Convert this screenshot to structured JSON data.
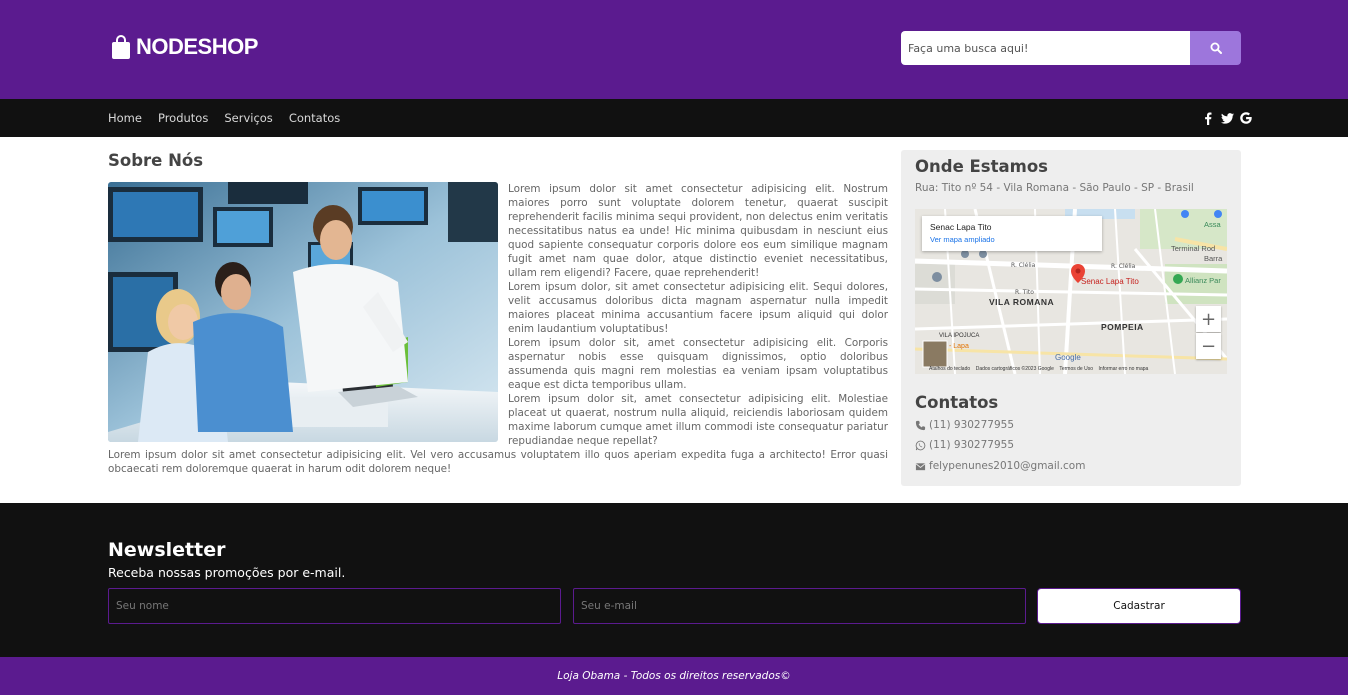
{
  "header": {
    "brand": "NODESHOP",
    "search_placeholder": "Faça uma busca aqui!",
    "colors": {
      "primary": "#5b1b8f",
      "search_button": "#9d76dc",
      "dark": "#111111"
    }
  },
  "nav": {
    "items": [
      {
        "label": "Home"
      },
      {
        "label": "Produtos"
      },
      {
        "label": "Serviços"
      },
      {
        "label": "Contatos"
      }
    ],
    "social_icons": [
      "facebook-icon",
      "twitter-icon",
      "google-icon"
    ]
  },
  "about": {
    "title": "Sobre Nós",
    "paragraphs": [
      "Lorem ipsum dolor sit amet consectetur adipisicing elit. Nostrum maiores porro sunt voluptate dolorem tenetur, quaerat suscipit reprehenderit facilis minima sequi provident, non delectus enim veritatis necessitatibus natus ea unde! Hic minima quibusdam in nesciunt eius quod sapiente consequatur corporis dolore eos eum similique magnam fugit amet nam quae dolor, atque distinctio eveniet necessitatibus, ullam rem eligendi? Facere, quae reprehenderit!",
      "Lorem ipsum dolor, sit amet consectetur adipisicing elit. Sequi dolores, velit accusamus doloribus dicta magnam aspernatur nulla impedit maiores placeat minima accusantium facere ipsum aliquid qui dolor enim laudantium voluptatibus!",
      "Lorem ipsum dolor sit, amet consectetur adipisicing elit. Corporis aspernatur nobis esse quisquam dignissimos, optio doloribus assumenda quis magni rem molestias ea veniam ipsam voluptatibus eaque est dicta temporibus ullam.",
      "Lorem ipsum dolor sit, amet consectetur adipisicing elit. Molestiae placeat ut quaerat, nostrum nulla aliquid, reiciendis laboriosam quidem maxime laborum cumque amet illum commodi iste consequatur pariatur repudiandae neque repellat?",
      "Lorem ipsum dolor sit amet consectetur adipisicing elit. Vel vero accusamus voluptatem illo quos aperiam expedita fuga a architecto! Error quasi obcaecati rem doloremque quaerat in harum odit dolorem neque!"
    ]
  },
  "location": {
    "title": "Onde Estamos",
    "address": "Rua: Tito nº 54 - Vila Romana - São Paulo - SP - Brasil",
    "map": {
      "place_name": "Senac Lapa Tito",
      "link": "Ver mapa ampliado",
      "marker_label": "Senac Lapa Tito",
      "labels": {
        "vila_romana": "VILA ROMANA",
        "pompeia": "POMPEIA",
        "vila_ipojuca": "VILA IPOJUCA",
        "lapa": "- Lapa",
        "terminal": "Terminal Rod",
        "barra": "Barra",
        "allianz": "Allianz Par",
        "clelia_1": "R. Clélia",
        "clelia_2": "R. Clélia",
        "tito": "R. Tito",
        "assa": "Assa",
        "google": "Google",
        "footer_shortcuts": "Atalhos do teclado",
        "footer_data": "Dados cartográficos ©2023 Google",
        "footer_terms": "Termos de Uso",
        "footer_report": "Informar erro no mapa"
      },
      "zoom_in": "+",
      "zoom_out": "−"
    }
  },
  "contacts": {
    "title": "Contatos",
    "phone": "(11) 930277955",
    "whatsapp": "(11) 930277955",
    "email": "felypenunes2010@gmail.com"
  },
  "newsletter": {
    "title": "Newsletter",
    "subtitle": "Receba nossas promoções por e-mail.",
    "name_placeholder": "Seu nome",
    "email_placeholder": "Seu e-mail",
    "button_label": "Cadastrar"
  },
  "footer": {
    "text": "Loja Obama - Todos os direitos reservados©"
  }
}
